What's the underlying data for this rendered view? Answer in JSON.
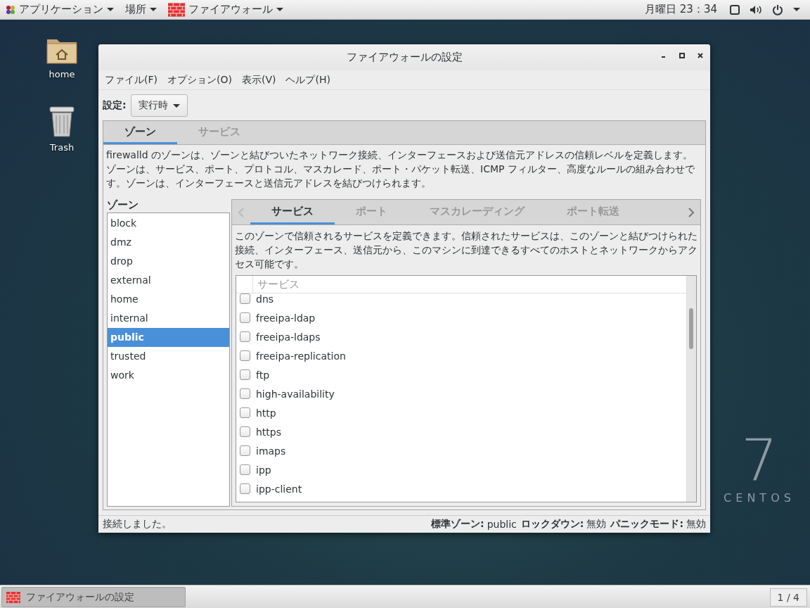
{
  "top_bar": {
    "menus": [
      {
        "label": "アプリケーション"
      },
      {
        "label": "場所"
      },
      {
        "label": "ファイアウォール"
      }
    ],
    "clock": "月曜日 23：34"
  },
  "desktop": {
    "icons": [
      {
        "kind": "folder",
        "label": "home"
      },
      {
        "kind": "trash",
        "label": "Trash"
      }
    ],
    "logo": {
      "number": "7",
      "name": "CENTOS"
    }
  },
  "window": {
    "title": "ファイアウォールの設定",
    "menu": [
      "ファイル(F)",
      "オプション(O)",
      "表示(V)",
      "ヘルプ(H)"
    ],
    "config": {
      "label": "設定:",
      "value": "実行時"
    },
    "tabs": [
      {
        "label": "ゾーン",
        "selected": true
      },
      {
        "label": "サービス",
        "selected": false
      }
    ],
    "description": "firewalld のゾーンは、ゾーンと結びついたネットワーク接続、インターフェースおよび送信元アドレスの信頼レベルを定義します。ゾーンは、サービス、ポート、プロトコル、マスカレード、ポート・パケット転送、ICMP フィルター、高度なルールの組み合わせです。ゾーンは、インターフェースと送信元アドレスを結びつけられます。",
    "zones": {
      "heading": "ゾーン",
      "items": [
        {
          "label": "block",
          "selected": false
        },
        {
          "label": "dmz",
          "selected": false
        },
        {
          "label": "drop",
          "selected": false
        },
        {
          "label": "external",
          "selected": false
        },
        {
          "label": "home",
          "selected": false
        },
        {
          "label": "internal",
          "selected": false
        },
        {
          "label": "public",
          "selected": true
        },
        {
          "label": "trusted",
          "selected": false
        },
        {
          "label": "work",
          "selected": false
        }
      ]
    },
    "zone_tabs": [
      {
        "label": "サービス",
        "selected": true
      },
      {
        "label": "ポート",
        "selected": false
      },
      {
        "label": "マスカレーディング",
        "selected": false
      },
      {
        "label": "ポート転送",
        "selected": false
      }
    ],
    "services_description": "このゾーンで信頼されるサービスを定義できます。信頼されたサービスは、このゾーンと結びつけられた接続、インターフェース、送信元から、このマシンに到達できるすべてのホストとネットワークからアクセス可能です。",
    "services": {
      "column": "サービス",
      "rows": [
        {
          "name": "dns",
          "checked": false
        },
        {
          "name": "freeipa-ldap",
          "checked": false
        },
        {
          "name": "freeipa-ldaps",
          "checked": false
        },
        {
          "name": "freeipa-replication",
          "checked": false
        },
        {
          "name": "ftp",
          "checked": false
        },
        {
          "name": "high-availability",
          "checked": false
        },
        {
          "name": "http",
          "checked": false
        },
        {
          "name": "https",
          "checked": false
        },
        {
          "name": "imaps",
          "checked": false
        },
        {
          "name": "ipp",
          "checked": false
        },
        {
          "name": "ipp-client",
          "checked": false
        }
      ]
    },
    "status": {
      "message": "接続しました。",
      "items": [
        {
          "label": "標準ゾーン:",
          "value": "public"
        },
        {
          "label": "ロックダウン:",
          "value": "無効"
        },
        {
          "label": "パニックモード:",
          "value": "無効"
        }
      ]
    }
  },
  "taskbar": {
    "window": "ファイアウォールの設定",
    "workspace": "1 / 4"
  }
}
